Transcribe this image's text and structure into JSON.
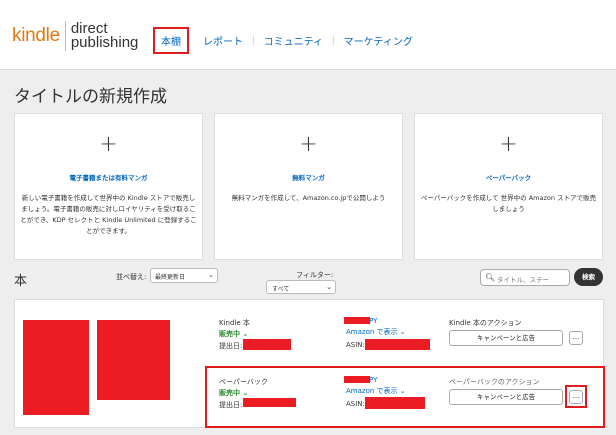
{
  "header": {
    "logo_kindle": "kindle",
    "logo_direct": "direct",
    "logo_publishing": "publishing",
    "nav": [
      "本棚",
      "レポート",
      "コミュニティ",
      "マーケティング"
    ],
    "nav_sep": "|"
  },
  "page_title": "タイトルの新規作成",
  "cards": [
    {
      "plus": "+",
      "title": "電子書籍または有料マンガ",
      "desc": "新しい電子書籍を作成して世界中の Kindle ストアで販売しましょう。電子書籍の販売に対しロイヤリティを受け取ることができ、KDP セレクトと Kindle Unlimited に登録することができます。"
    },
    {
      "plus": "+",
      "title": "無料マンガ",
      "desc": "無料マンガを作成して、Amazon.co.jpで公開しよう"
    },
    {
      "plus": "+",
      "title": "ペーパーバック",
      "desc": "ペーパーバックを作成して 世界中の Amazon ストアで販売しましょう"
    }
  ],
  "shelf": {
    "title": "本",
    "sort_label": "並べ替え:",
    "sort_value": "最終更新日",
    "filter_label": "フィルター:",
    "filter_value": "すべて",
    "search_placeholder": "タイトル、ステー",
    "search_button": "検索"
  },
  "books": [
    {
      "format": "Kindle 本",
      "status": "販売中 ⌄",
      "submitted_label": "提出日:",
      "title_suffix": "PY",
      "amazon_link": "Amazon で表示 ⌄",
      "asin_label": "ASIN:",
      "actions_title": "Kindle 本のアクション",
      "campaign_button": "キャンペーンと広告",
      "more_button": "..."
    },
    {
      "format": "ペーパーバック",
      "status": "販売中 ⌄",
      "submitted_label": "提出日:",
      "title_suffix": "PY",
      "amazon_link": "Amazon で表示 ⌄",
      "asin_label": "ASIN:",
      "actions_title": "ペーパーバックのアクション",
      "campaign_button": "キャンペーンと広告",
      "more_button": "..."
    }
  ],
  "icons": {
    "search": "search-icon",
    "chevron": "chevron-down-icon",
    "plus": "plus-icon"
  },
  "colors": {
    "highlight": "#e21c1c",
    "redaction": "#ec1c24",
    "link": "#0066c0",
    "status_green": "#2e8b2e",
    "logo_orange": "#e47911"
  }
}
